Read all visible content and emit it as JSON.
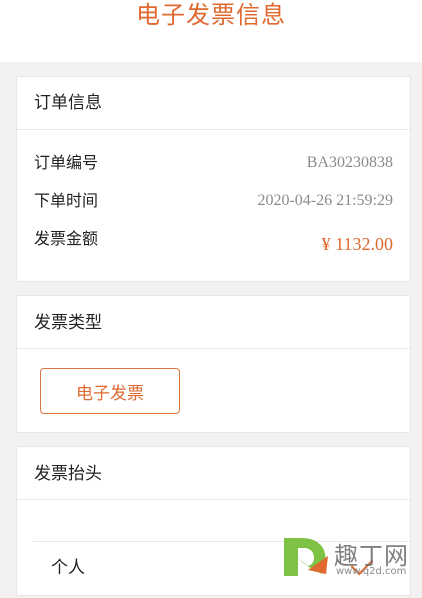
{
  "header": {
    "title": "电子发票信息"
  },
  "order": {
    "title": "订单信息",
    "rows": [
      {
        "label": "订单编号",
        "value": "BA30230838"
      },
      {
        "label": "下单时间",
        "value": "2020-04-26 21:59:29"
      },
      {
        "label": "发票金额",
        "value": "¥ 1132.00"
      }
    ]
  },
  "invoice_type": {
    "title": "发票类型",
    "selected": "电子发票"
  },
  "invoice_header": {
    "title": "发票抬头",
    "options": [
      {
        "label": "个人",
        "selected": true
      }
    ]
  },
  "watermark": {
    "brand": "趣丁网",
    "url": "www.q2d.com"
  },
  "colors": {
    "accent": "#e0692f",
    "background": "#f2f2f2",
    "card": "#ffffff"
  }
}
